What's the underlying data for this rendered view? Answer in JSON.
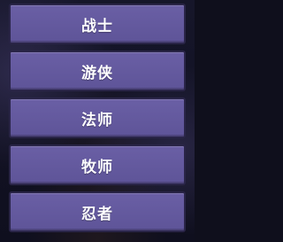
{
  "class_menu": {
    "options": [
      {
        "label": "战士"
      },
      {
        "label": "游侠"
      },
      {
        "label": "法师"
      },
      {
        "label": "牧师"
      },
      {
        "label": "忍者"
      }
    ]
  }
}
